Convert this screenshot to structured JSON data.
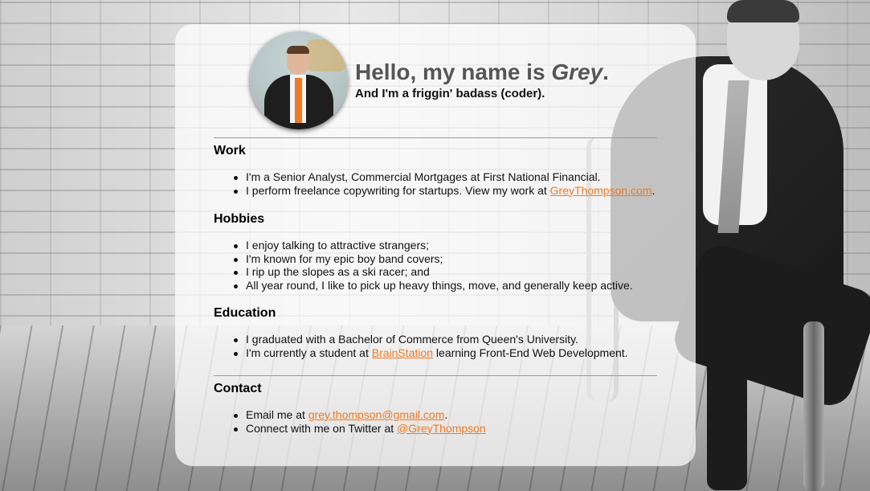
{
  "header": {
    "greeting_prefix": "Hello, my name is ",
    "name": "Grey",
    "greeting_suffix": ".",
    "tagline": "And I'm a friggin' badass (coder)."
  },
  "work": {
    "title": "Work",
    "item1": "I'm a Senior Analyst, Commercial Mortgages at First National Financial.",
    "item2_prefix": "I perform freelance copywriting for startups. View my work at ",
    "item2_link": "GreyThompson.com",
    "item2_suffix": "."
  },
  "hobbies": {
    "title": "Hobbies",
    "items": [
      "I enjoy talking to attractive strangers;",
      "I'm known for my epic boy band covers;",
      "I rip up the slopes as a ski racer; and",
      "All year round, I like to pick up heavy things, move, and generally keep active."
    ]
  },
  "education": {
    "title": "Education",
    "item1": "I graduated with a Bachelor of Commerce from Queen's University.",
    "item2_prefix": "I'm currently a student at ",
    "item2_link": "BrainStation",
    "item2_suffix": " learning Front-End Web Development."
  },
  "contact": {
    "title": "Contact",
    "email_prefix": "Email me at ",
    "email_link": "grey.thompson@gmail.com",
    "email_suffix": ".",
    "twitter_prefix": "Connect with me on Twitter at ",
    "twitter_link": "@GreyThompson"
  },
  "colors": {
    "accent": "#f07a23",
    "card_background": "rgba(255,255,255,0.72)"
  }
}
